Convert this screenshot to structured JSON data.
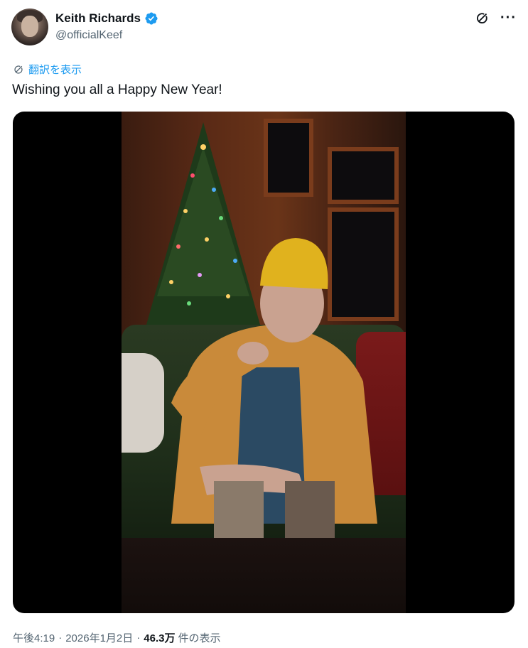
{
  "author": {
    "display_name": "Keith Richards",
    "handle": "@officialKeef",
    "verified": true
  },
  "header_icons": [
    "grok-icon",
    "more-icon"
  ],
  "translate": {
    "label": "翻訳を表示",
    "icon": "translate-icon"
  },
  "tweet": {
    "text": "Wishing you all a Happy New Year!"
  },
  "meta": {
    "time": "午後4:19",
    "separator": "·",
    "date": "2026年1月2日",
    "views_count": "46.3万",
    "views_label": "件の表示"
  },
  "colors": {
    "accent": "#1d9bf0",
    "text_primary": "#0f1419",
    "text_secondary": "#536471"
  }
}
